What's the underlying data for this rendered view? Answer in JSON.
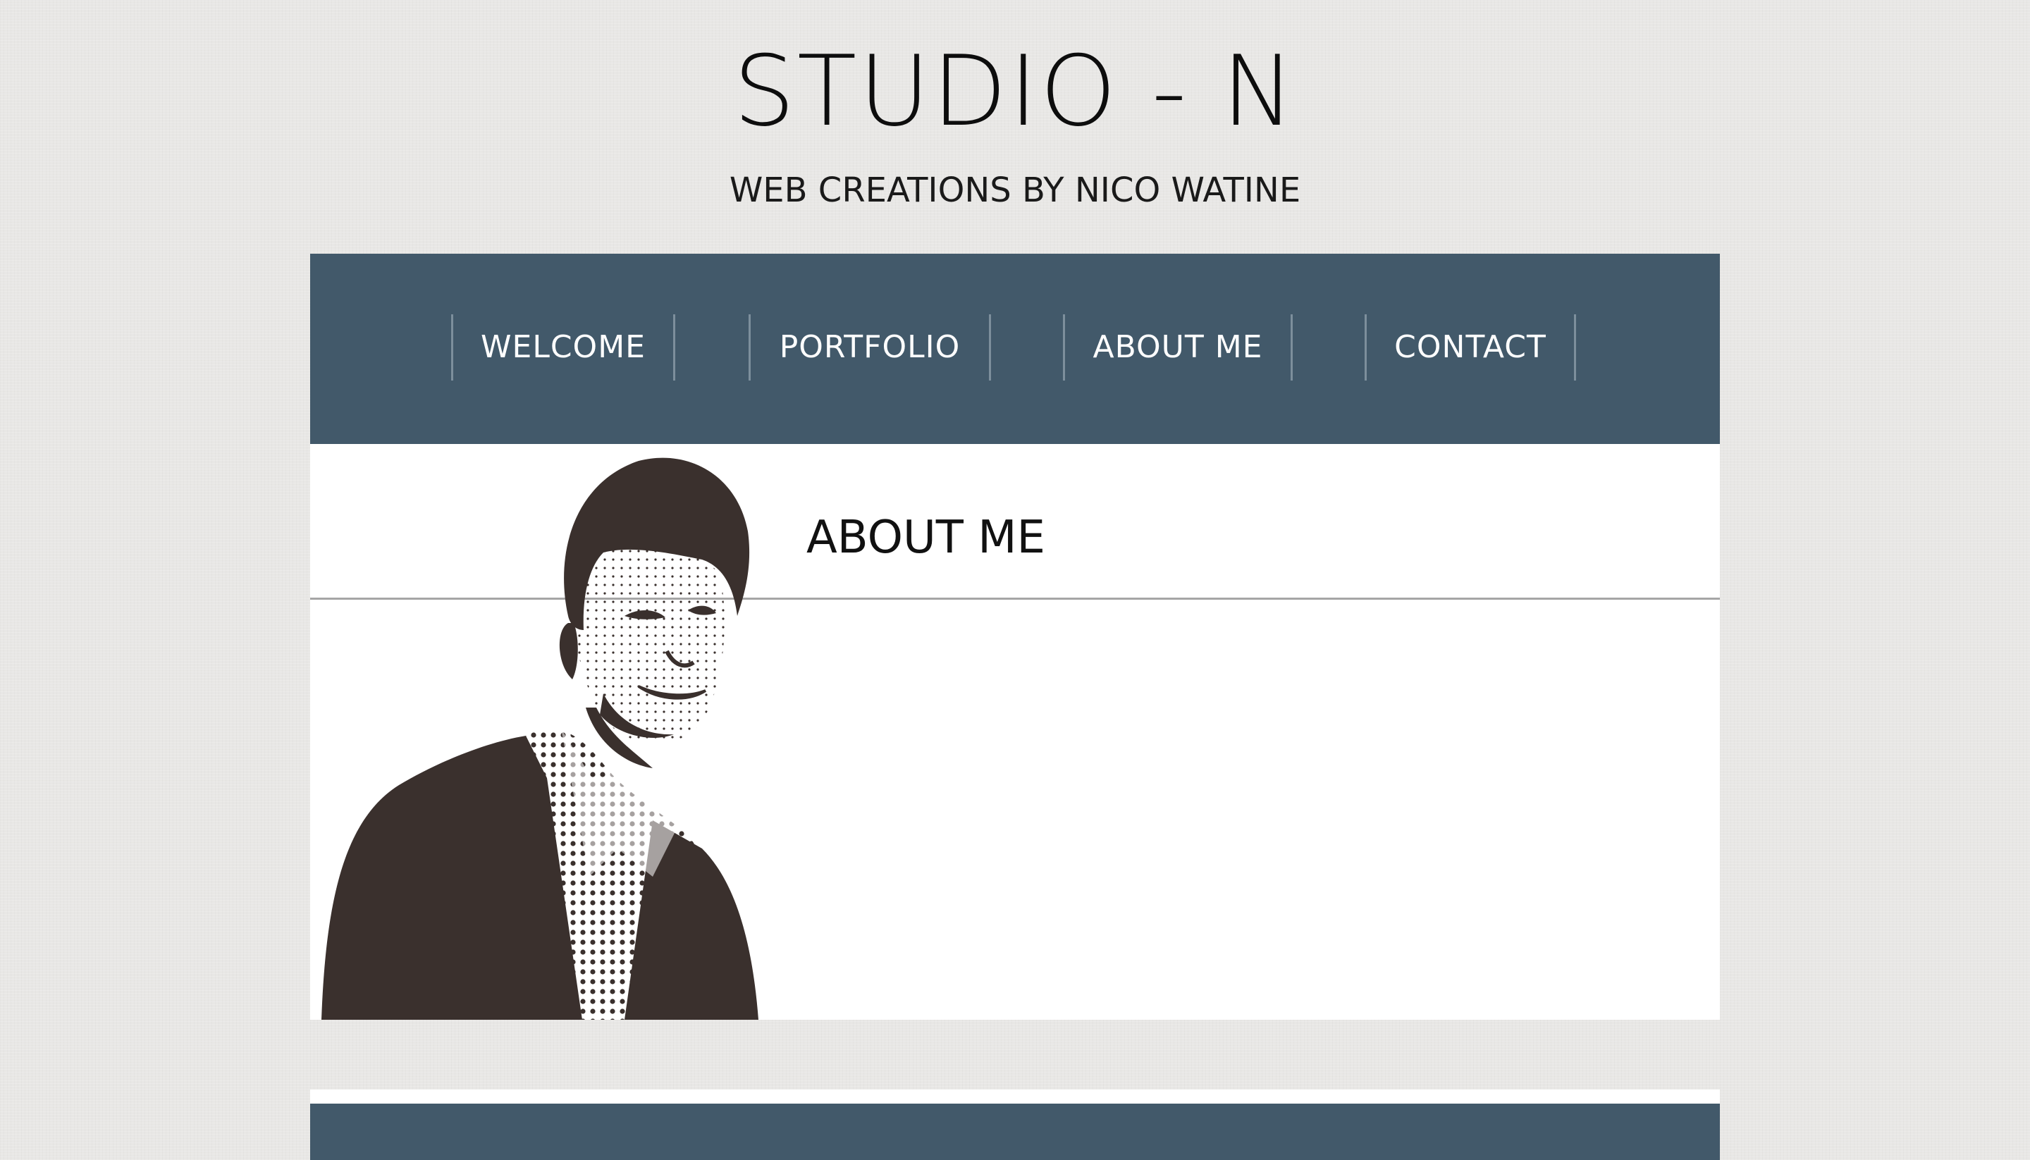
{
  "header": {
    "title": "STUDIO - N",
    "tagline": "WEB CREATIONS BY NICO WATINE"
  },
  "nav": {
    "items": [
      {
        "label": "WELCOME"
      },
      {
        "label": "PORTFOLIO"
      },
      {
        "label": "ABOUT ME"
      },
      {
        "label": "CONTACT"
      }
    ]
  },
  "main": {
    "heading": "ABOUT ME",
    "portrait_icon": "person-portrait-icon"
  },
  "colors": {
    "nav_background": "#42596a",
    "page_background": "#e8e7e5",
    "panel_background": "#ffffff",
    "portrait_ink": "#3a302d"
  }
}
